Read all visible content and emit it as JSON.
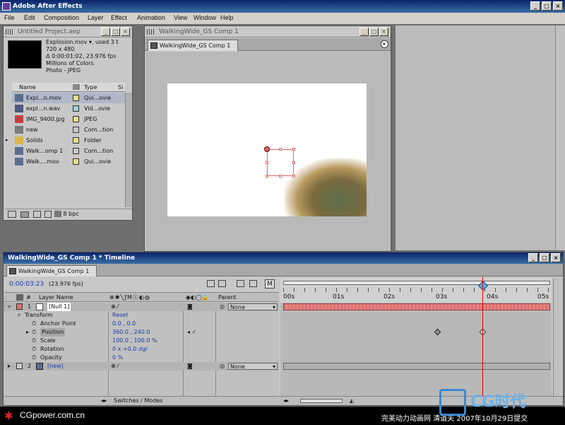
{
  "window": {
    "title": "Adobe After Effects",
    "controls": [
      "_",
      "□",
      "×"
    ]
  },
  "menubar": {
    "items": [
      "File",
      "Edit",
      "Composition",
      "Layer",
      "Effect",
      "Animation",
      "View",
      "Window",
      "Help"
    ]
  },
  "project": {
    "title": "Untitled Project.aep",
    "preview_info": [
      "Explosion.mov ▾, used 3 t",
      "720 x 480",
      "Δ 0:00:01:02, 23.976 fps",
      "Millions of Colors",
      "Photo - JPEG"
    ],
    "columns": {
      "name": "Name",
      "type": "Type",
      "size": "Si"
    },
    "items": [
      {
        "name": "Expl...n.mov",
        "type": "Qui...ovie",
        "color": "#e8e08a",
        "icon": "movie-icon"
      },
      {
        "name": "expl...n.wav",
        "type": "Vid...ovie",
        "color": "#9fd0d8",
        "icon": "audio-icon"
      },
      {
        "name": "IMG_9400.jpg",
        "type": "JPEG",
        "color": "#e8e08a",
        "icon": "image-icon"
      },
      {
        "name": "new",
        "type": "Com...tion",
        "color": "#c8c8c8",
        "icon": "folder-icon"
      },
      {
        "name": "Solids",
        "type": "Folder",
        "color": "#e8e08a",
        "icon": "folder-icon"
      },
      {
        "name": "Walk...omp 1",
        "type": "Com...tion",
        "color": "#c8c8c8",
        "icon": "comp-icon"
      },
      {
        "name": "Walk....mov",
        "type": "Qui...ovie",
        "color": "#e8e08a",
        "icon": "movie-icon"
      }
    ],
    "footer_bpc": "8 bpc"
  },
  "comp_viewer": {
    "title": "WalkingWide_GS Comp 1",
    "tab": "WalkingWide_GS Comp 1"
  },
  "timeline": {
    "title": "WalkingWide_GS Comp 1 * Timeline",
    "tab": "WalkingWide_GS Comp 1",
    "timecode": "0:00:03:23",
    "fps": "(23.976 fps)",
    "col_layer_name": "Layer Name",
    "col_parent": "Parent",
    "ruler": [
      "00s",
      "01s",
      "02s",
      "03s",
      "04s",
      "05s"
    ],
    "layers": [
      {
        "num": "1",
        "name": "[Null 1]",
        "parent": "None"
      },
      {
        "num": "2",
        "name": "[new]",
        "parent": "None"
      }
    ],
    "transform": {
      "label": "Transform",
      "reset": "Reset",
      "props": [
        {
          "name": "Anchor Point",
          "value": "0.0 , 0.0"
        },
        {
          "name": "Position",
          "value": "360.0 , 240.0"
        },
        {
          "name": "Scale",
          "value": "100.0 , 100.0 %"
        },
        {
          "name": "Rotation",
          "value": "0 x +0.0 dgr"
        },
        {
          "name": "Opacity",
          "value": "0 %"
        }
      ]
    },
    "footer": "Switches / Modes",
    "m_label": "M"
  },
  "watermark": {
    "left": "CGpower.com.cn",
    "right": "完美动力动画网 清道夫 2007年10月29日提交",
    "logo": "CG时代"
  },
  "colors": {
    "title_active": "#0a246a",
    "panel_bg": "#c8c8c8",
    "timecode_blue": "#1a3aa8",
    "layer_bar": "#e07070",
    "playhead": "#e00000"
  }
}
